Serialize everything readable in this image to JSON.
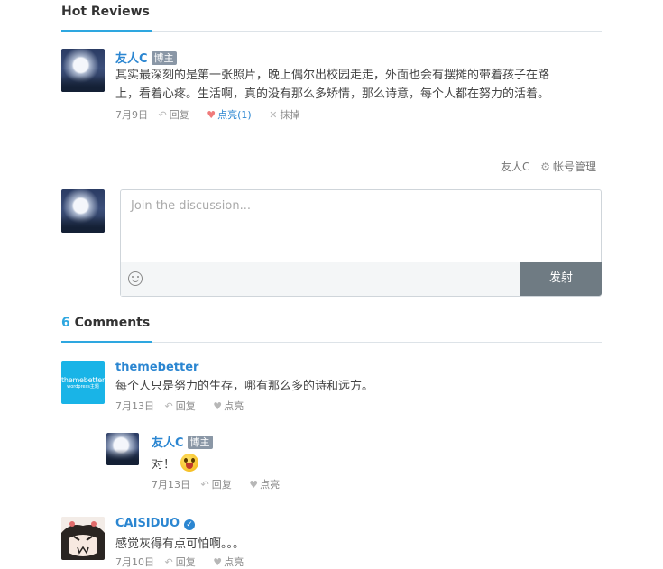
{
  "hot_reviews": {
    "title": "Hot Reviews",
    "comment": {
      "author": "友人C",
      "badge": "博主",
      "text_line1": "其实最深刻的是第一张照片，晚上偶尔出校园走走，外面也会有摆摊的带着孩子在路",
      "text_line2": "上，看着心疼。生活啊，真的没有那么多矫情，那么诗意，每个人都在努力的活着。",
      "date": "7月9日",
      "reply_label": "回复",
      "like_label": "点亮(1)",
      "remove_label": "抹掉"
    }
  },
  "account": {
    "user": "友人C",
    "manage_label": "帐号管理"
  },
  "reply_box": {
    "placeholder": "Join the discussion...",
    "submit_label": "发射"
  },
  "comments": {
    "count": "6",
    "title": "Comments",
    "items": [
      {
        "author": "themebetter",
        "avatar_line1": "themebetter",
        "avatar_line2": "wordpress主题",
        "text": "每个人只是努力的生存，哪有那么多的诗和远方。",
        "date": "7月13日",
        "reply_label": "回复",
        "like_label": "点亮"
      },
      {
        "author": "友人C",
        "badge": "博主",
        "text": "对！",
        "date": "7月13日",
        "reply_label": "回复",
        "like_label": "点亮"
      },
      {
        "author": "CAISIDUO",
        "text": "感觉灰得有点可怕啊。。。",
        "date": "7月10日",
        "reply_label": "回复",
        "like_label": "点亮"
      }
    ]
  },
  "colors": {
    "accent": "#2ea7e0",
    "author": "#2b86d1",
    "badge": "#8a97a6",
    "submit": "#6f7b83"
  },
  "icons": [
    "reply-icon",
    "heart-icon",
    "close-icon",
    "gear-icon",
    "emoji-icon",
    "verified-icon"
  ]
}
